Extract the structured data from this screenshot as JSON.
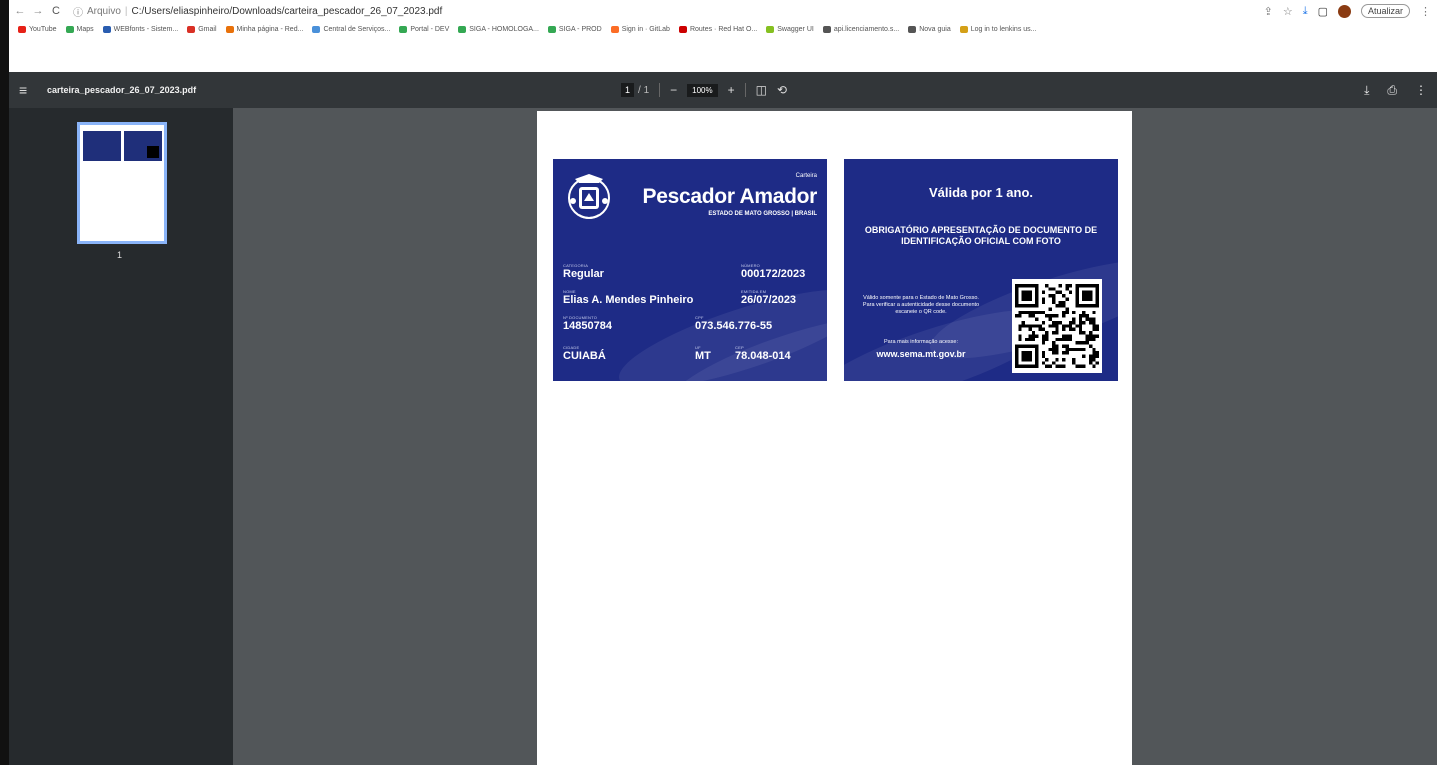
{
  "browser": {
    "scheme": "Arquivo",
    "path": "C:/Users/eliaspinheiro/Downloads/carteira_pescador_26_07_2023.pdf",
    "update_label": "Atualizar"
  },
  "bookmarks": [
    {
      "label": "YouTube",
      "color": "#e62117"
    },
    {
      "label": "Maps",
      "color": "#34a853"
    },
    {
      "label": "WEBfonts - Sistem...",
      "color": "#2a5db0"
    },
    {
      "label": "Gmail",
      "color": "#d93025"
    },
    {
      "label": "Minha página - Red...",
      "color": "#e8710a"
    },
    {
      "label": "Central de Serviços...",
      "color": "#4a90d9"
    },
    {
      "label": "Portal - DEV",
      "color": "#34a853"
    },
    {
      "label": "SIGA - HOMOLOGA...",
      "color": "#34a853"
    },
    {
      "label": "SIGA - PROD",
      "color": "#34a853"
    },
    {
      "label": "Sign in · GitLab",
      "color": "#fc6d26"
    },
    {
      "label": "Routes · Red Hat O...",
      "color": "#cc0000"
    },
    {
      "label": "Swagger UI",
      "color": "#85c020"
    },
    {
      "label": "api.licenciamento.s...",
      "color": "#555555"
    },
    {
      "label": "Nova guia",
      "color": "#555555"
    },
    {
      "label": "Log in to lenkins us...",
      "color": "#d4a017"
    }
  ],
  "pdf_toolbar": {
    "filename": "carteira_pescador_26_07_2023.pdf",
    "page_current": "1",
    "page_total": "/ 1",
    "zoom": "100%"
  },
  "thumbnail": {
    "label": "1"
  },
  "card_front": {
    "kicker": "Carteira",
    "title": "Pescador Amador",
    "subtitle": "ESTADO DE MATO GROSSO | BRASIL",
    "categoria_label": "Categoria",
    "categoria": "Regular",
    "numero_label": "Número",
    "numero": "000172/2023",
    "nome_label": "Nome",
    "nome": "Elias A. Mendes Pinheiro",
    "emitida_label": "Emitida em",
    "emitida": "26/07/2023",
    "rg_label": "Nº Documento",
    "rg": "14850784",
    "cpf_label": "CPF",
    "cpf": "073.546.776-55",
    "cidade_label": "Cidade",
    "cidade": "CUIABÁ",
    "uf_label": "UF",
    "uf": "MT",
    "cep_label": "CEP",
    "cep": "78.048-014"
  },
  "card_back": {
    "title": "Válida por 1 ano.",
    "obligation": "OBRIGATÓRIO APRESENTAÇÃO DE DOCUMENTO DE IDENTIFICAÇÃO OFICIAL COM FOTO",
    "info": "Válido somente para o Estado de Mato Grosso. Para verificar a autenticidade desse documento escaneie o QR code.",
    "more": "Para mais informação acesse:",
    "site": "www.sema.mt.gov.br"
  },
  "colors": {
    "card_blue": "#1e2b86",
    "toolbar": "#323639",
    "viewer_bg": "#525659",
    "sidebar": "#262a2d"
  }
}
